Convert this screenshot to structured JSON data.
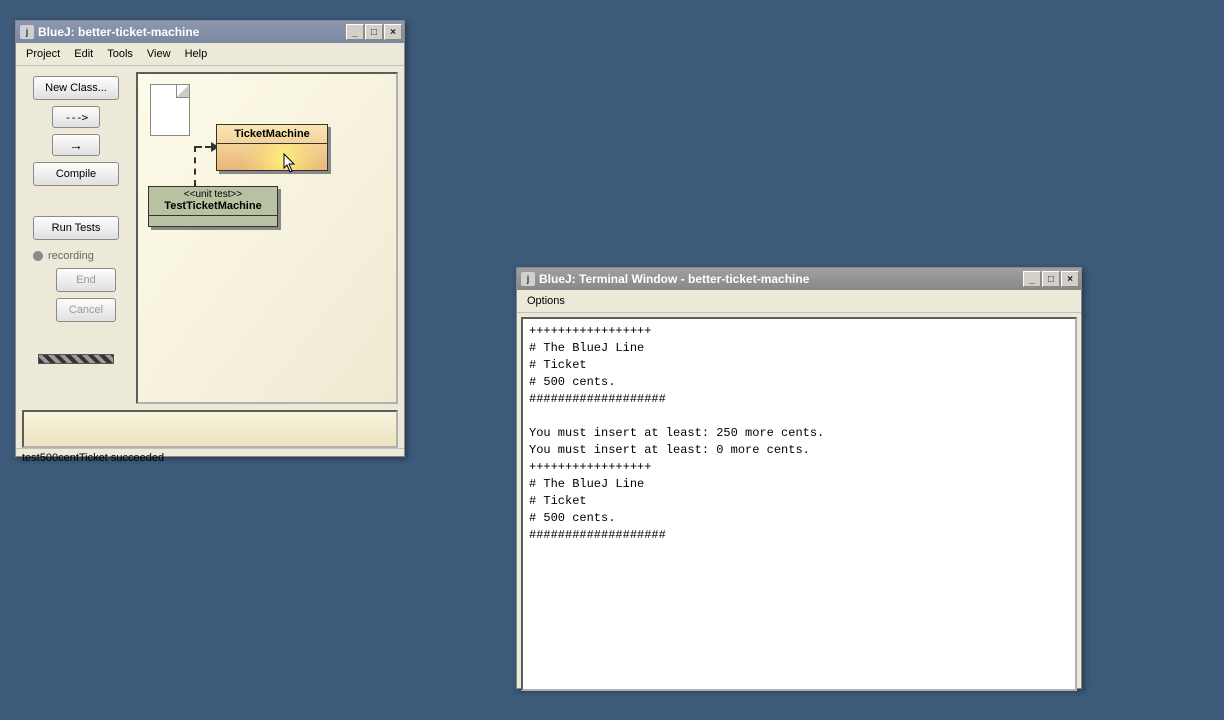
{
  "main": {
    "title": "BlueJ:  better-ticket-machine",
    "menu": {
      "project": "Project",
      "edit": "Edit",
      "tools": "Tools",
      "view": "View",
      "help": "Help"
    },
    "buttons": {
      "new_class": "New Class...",
      "dep_dashed": "--->",
      "dep_solid": "→",
      "compile": "Compile",
      "run_tests": "Run Tests",
      "recording": "recording",
      "end": "End",
      "cancel": "Cancel"
    },
    "classes": {
      "ticketmachine": "TicketMachine",
      "test_stereo": "<<unit test>>",
      "test_name": "TestTicketMachine"
    },
    "status": "test500centTicket succeeded"
  },
  "terminal": {
    "title": "BlueJ:  Terminal Window - better-ticket-machine",
    "menu": {
      "options": "Options"
    },
    "output": "+++++++++++++++++\n# The BlueJ Line\n# Ticket\n# 500 cents.\n###################\n\nYou must insert at least: 250 more cents.\nYou must insert at least: 0 more cents.\n+++++++++++++++++\n# The BlueJ Line\n# Ticket\n# 500 cents.\n###################"
  }
}
